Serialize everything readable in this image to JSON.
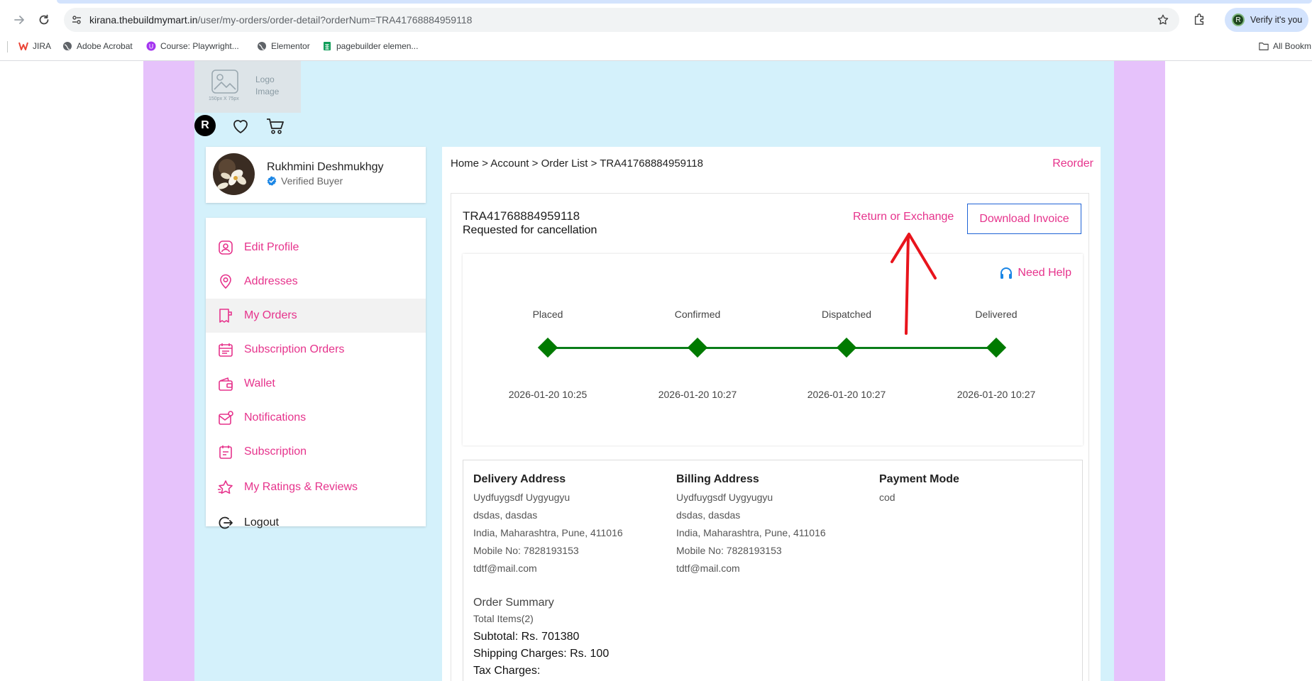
{
  "browser": {
    "url_host": "kirana.thebuildmymart.in",
    "url_path": "/user/my-orders/order-detail?orderNum=TRA41768884959118",
    "profile_label": "Verify it's you",
    "profile_initial": "R",
    "bookmarks": [
      {
        "label": "JIRA",
        "icon": "jira-icon"
      },
      {
        "label": "Adobe Acrobat",
        "icon": "globe-icon"
      },
      {
        "label": "Course: Playwright...",
        "icon": "course-icon"
      },
      {
        "label": "Elementor",
        "icon": "globe-icon"
      },
      {
        "label": "pagebuilder elemen...",
        "icon": "sheets-icon"
      }
    ],
    "all_bookmarks": "All Bookm"
  },
  "header": {
    "logo_text": "Logo Image",
    "logo_line1": "Logo",
    "logo_line2": "Image",
    "logo_dims": "150px X 75px",
    "user_initial": "R"
  },
  "profile": {
    "name": "Rukhmini Deshmukhgy",
    "badge": "Verified Buyer"
  },
  "menu": {
    "items": [
      {
        "label": "Edit Profile",
        "icon": "user-icon"
      },
      {
        "label": "Addresses",
        "icon": "location-pin-icon"
      },
      {
        "label": "My Orders",
        "icon": "orders-icon"
      },
      {
        "label": "Subscription Orders",
        "icon": "subscription-orders-icon"
      },
      {
        "label": "Wallet",
        "icon": "wallet-icon"
      },
      {
        "label": "Notifications",
        "icon": "notification-icon"
      },
      {
        "label": "Subscription",
        "icon": "subscription-icon"
      },
      {
        "label": "My Ratings & Reviews",
        "icon": "star-icon"
      },
      {
        "label": "Logout",
        "icon": "logout-icon"
      }
    ],
    "active_index": 2
  },
  "order": {
    "breadcrumb": "Home > Account > Order List > TRA41768884959118",
    "reorder": "Reorder",
    "id": "TRA41768884959118",
    "status": "Requested for cancellation",
    "return_exchange": "Return or Exchange",
    "download_invoice": "Download Invoice",
    "need_help": "Need Help",
    "steps": [
      {
        "label": "Placed",
        "date": "2026-01-20 10:25"
      },
      {
        "label": "Confirmed",
        "date": "2026-01-20 10:27"
      },
      {
        "label": "Dispatched",
        "date": "2026-01-20 10:27"
      },
      {
        "label": "Delivered",
        "date": "2026-01-20 10:27"
      }
    ],
    "delivery": {
      "title": "Delivery Address",
      "lines": [
        "Uydfuygsdf Uygyugyu",
        "dsdas, dasdas",
        "India, Maharashtra, Pune, 411016",
        "Mobile No: 7828193153",
        "tdtf@mail.com"
      ]
    },
    "billing": {
      "title": "Billing Address",
      "lines": [
        "Uydfuygsdf Uygyugyu",
        "dsdas, dasdas",
        "India, Maharashtra, Pune, 411016",
        "Mobile No: 7828193153",
        "tdtf@mail.com"
      ]
    },
    "payment": {
      "title": "Payment Mode",
      "value": "cod"
    },
    "summary": {
      "title": "Order Summary",
      "total_items": "Total Items(2)",
      "subtotal": "Subtotal: Rs. 701380",
      "shipping": "Shipping Charges: Rs. 100",
      "tax": "Tax Charges:",
      "info": "info-circle"
    }
  },
  "colors": {
    "accent_pink": "#e6338c",
    "track_green": "#007a00",
    "side_purple": "#e6c2fb",
    "bg_cyan": "#d4f1fb",
    "annotation_red": "#e8141c"
  }
}
